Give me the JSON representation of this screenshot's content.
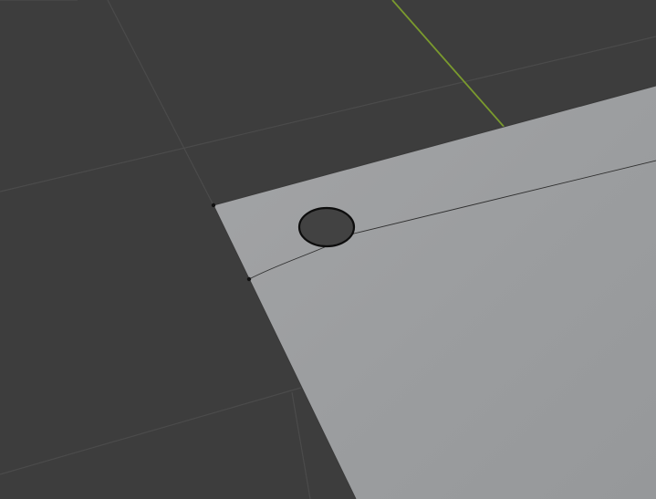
{
  "app": {
    "window_type": "3d-viewport",
    "view": "perspective"
  },
  "colors": {
    "background": "#3d3d3d",
    "grid_line": "#4a4a4a",
    "y_axis": "#6b8e23",
    "mesh_face": "#9a9c9e",
    "mesh_edge": "#2a2a2a",
    "vertex": "#111111",
    "hole_fill": "#424242",
    "hole_outline": "#0d0d0d"
  },
  "scene": {
    "object": "plane-mesh",
    "mode": "edit",
    "selection_type": "vertex",
    "features": [
      "plane-face",
      "bevel-edge",
      "circular-hole",
      "corner-vertices"
    ]
  }
}
